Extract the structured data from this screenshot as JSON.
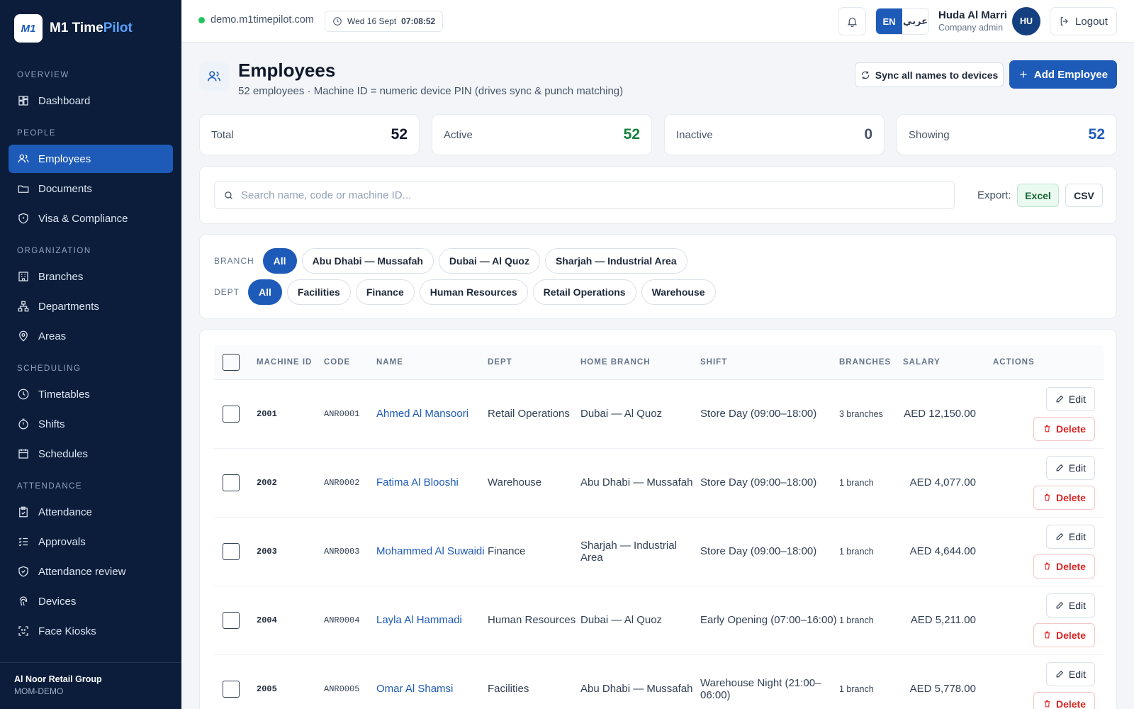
{
  "brand": {
    "name_a": "M1 Time",
    "name_b": "Pilot",
    "logo": "M1"
  },
  "nav": [
    {
      "section": "OVERVIEW",
      "items": [
        {
          "label": "Dashboard",
          "icon": "dashboard-icon"
        }
      ]
    },
    {
      "section": "PEOPLE",
      "items": [
        {
          "label": "Employees",
          "icon": "users-icon",
          "active": true
        },
        {
          "label": "Documents",
          "icon": "folder-icon"
        },
        {
          "label": "Visa & Compliance",
          "icon": "shield-icon"
        }
      ]
    },
    {
      "section": "ORGANIZATION",
      "items": [
        {
          "label": "Branches",
          "icon": "building-icon"
        },
        {
          "label": "Departments",
          "icon": "hierarchy-icon"
        },
        {
          "label": "Areas",
          "icon": "map-pin-icon"
        }
      ]
    },
    {
      "section": "SCHEDULING",
      "items": [
        {
          "label": "Timetables",
          "icon": "clock-icon"
        },
        {
          "label": "Shifts",
          "icon": "timer-icon"
        },
        {
          "label": "Schedules",
          "icon": "calendar-icon"
        }
      ]
    },
    {
      "section": "ATTENDANCE",
      "items": [
        {
          "label": "Attendance",
          "icon": "clipboard-check-icon"
        },
        {
          "label": "Approvals",
          "icon": "list-check-icon"
        },
        {
          "label": "Attendance review",
          "icon": "shield-check-icon"
        },
        {
          "label": "Devices",
          "icon": "fingerprint-icon"
        },
        {
          "label": "Face Kiosks",
          "icon": "face-scan-icon"
        }
      ]
    }
  ],
  "org": {
    "name": "Al Noor Retail Group",
    "code": "MOM-DEMO"
  },
  "topbar": {
    "domain": "demo.m1timepilot.com",
    "date": "Wed 16 Sept",
    "time": "07:08:52",
    "lang_en": "EN",
    "lang_ar": "عربي",
    "user_name": "Huda Al Marri",
    "user_role": "Company admin",
    "avatar": "HU",
    "logout": "Logout"
  },
  "page": {
    "title": "Employees",
    "subtitle": "52 employees · Machine ID = numeric device PIN (drives sync & punch matching)",
    "sync_label": "Sync all names to devices",
    "add_label": "Add Employee"
  },
  "stats": [
    {
      "label": "Total",
      "value": "52",
      "color": "#0f172a"
    },
    {
      "label": "Active",
      "value": "52",
      "color": "#15803d"
    },
    {
      "label": "Inactive",
      "value": "0",
      "color": "#475569"
    },
    {
      "label": "Showing",
      "value": "52",
      "color": "#1e5bb8"
    }
  ],
  "search": {
    "placeholder": "Search name, code or machine ID...",
    "export_label": "Export:",
    "excel": "Excel",
    "csv": "CSV"
  },
  "filters": {
    "branch_label": "BRANCH",
    "branches": [
      "All",
      "Abu Dhabi — Mussafah",
      "Dubai — Al Quoz",
      "Sharjah — Industrial Area"
    ],
    "dept_label": "DEPT",
    "depts": [
      "All",
      "Facilities",
      "Finance",
      "Human Resources",
      "Retail Operations",
      "Warehouse"
    ]
  },
  "table": {
    "headers": [
      "MACHINE ID",
      "CODE",
      "NAME",
      "DEPT",
      "HOME BRANCH",
      "SHIFT",
      "BRANCHES",
      "SALARY",
      "ACTIONS"
    ],
    "edit_label": "Edit",
    "delete_label": "Delete",
    "rows": [
      {
        "mid": "2001",
        "code": "ANR0001",
        "name": "Ahmed Al Mansoori",
        "dept": "Retail Operations",
        "branch": "Dubai — Al Quoz",
        "shift": "Store Day (09:00–18:00)",
        "branches": "3 branches",
        "salary": "AED 12,150.00"
      },
      {
        "mid": "2002",
        "code": "ANR0002",
        "name": "Fatima Al Blooshi",
        "dept": "Warehouse",
        "branch": "Abu Dhabi — Mussafah",
        "shift": "Store Day (09:00–18:00)",
        "branches": "1 branch",
        "salary": "AED 4,077.00"
      },
      {
        "mid": "2003",
        "code": "ANR0003",
        "name": "Mohammed Al Suwaidi",
        "dept": "Finance",
        "branch": "Sharjah — Industrial Area",
        "shift": "Store Day (09:00–18:00)",
        "branches": "1 branch",
        "salary": "AED 4,644.00"
      },
      {
        "mid": "2004",
        "code": "ANR0004",
        "name": "Layla Al Hammadi",
        "dept": "Human Resources",
        "branch": "Dubai — Al Quoz",
        "shift": "Early Opening (07:00–16:00)",
        "branches": "1 branch",
        "salary": "AED 5,211.00"
      },
      {
        "mid": "2005",
        "code": "ANR0005",
        "name": "Omar Al Shamsi",
        "dept": "Facilities",
        "branch": "Abu Dhabi — Mussafah",
        "shift": "Warehouse Night (21:00–06:00)",
        "branches": "1 branch",
        "salary": "AED 5,778.00"
      }
    ]
  }
}
